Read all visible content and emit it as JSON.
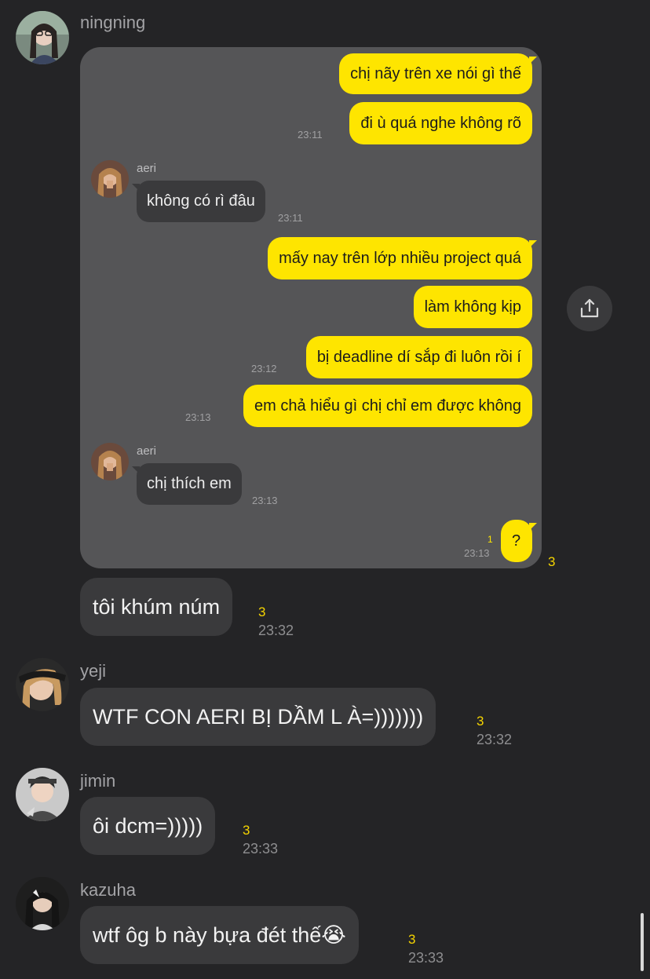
{
  "colors": {
    "background": "#242426",
    "bubble": "#3a3a3c",
    "card": "#555557",
    "yellow_bubble": "#fee500",
    "unread": "#f5d400"
  },
  "messages": [
    {
      "sender": "ningning",
      "avatar_icon": "profile-photo",
      "image": {
        "chat": [
          {
            "type": "out",
            "text": "chị nãy trên xe nói gì thế"
          },
          {
            "type": "out",
            "text": "đi ù quá nghe không rõ",
            "time": "23:11"
          },
          {
            "type": "in",
            "name": "aeri",
            "text": "không có rì đâu",
            "time": "23:11"
          },
          {
            "type": "out",
            "text": "mấy nay trên lớp nhiều project quá"
          },
          {
            "type": "out",
            "text": "làm không kịp"
          },
          {
            "type": "out",
            "text": "bị deadline dí sắp đi luôn rồi í",
            "time": "23:12"
          },
          {
            "type": "out",
            "text": "em chả hiểu gì chị chỉ em được không",
            "time": "23:13"
          },
          {
            "type": "in",
            "name": "aeri",
            "text": "chị thích em",
            "time": "23:13"
          },
          {
            "type": "out",
            "text": "?",
            "time": "23:13",
            "unread": "1"
          }
        ]
      },
      "image_unread": "3",
      "text": "tôi khúm núm",
      "unread": "3",
      "time": "23:32"
    },
    {
      "sender": "yeji",
      "text": "WTF CON AERI BỊ DẦM L À=)))))))",
      "unread": "3",
      "time": "23:32"
    },
    {
      "sender": "jimin",
      "text": "ôi dcm=)))))",
      "unread": "3",
      "time": "23:33"
    },
    {
      "sender": "kazuha",
      "text": "wtf ôg b này bựa đét thế😭",
      "unread": "3",
      "time": "23:33"
    }
  ],
  "share_button": {
    "icon": "share-icon"
  }
}
